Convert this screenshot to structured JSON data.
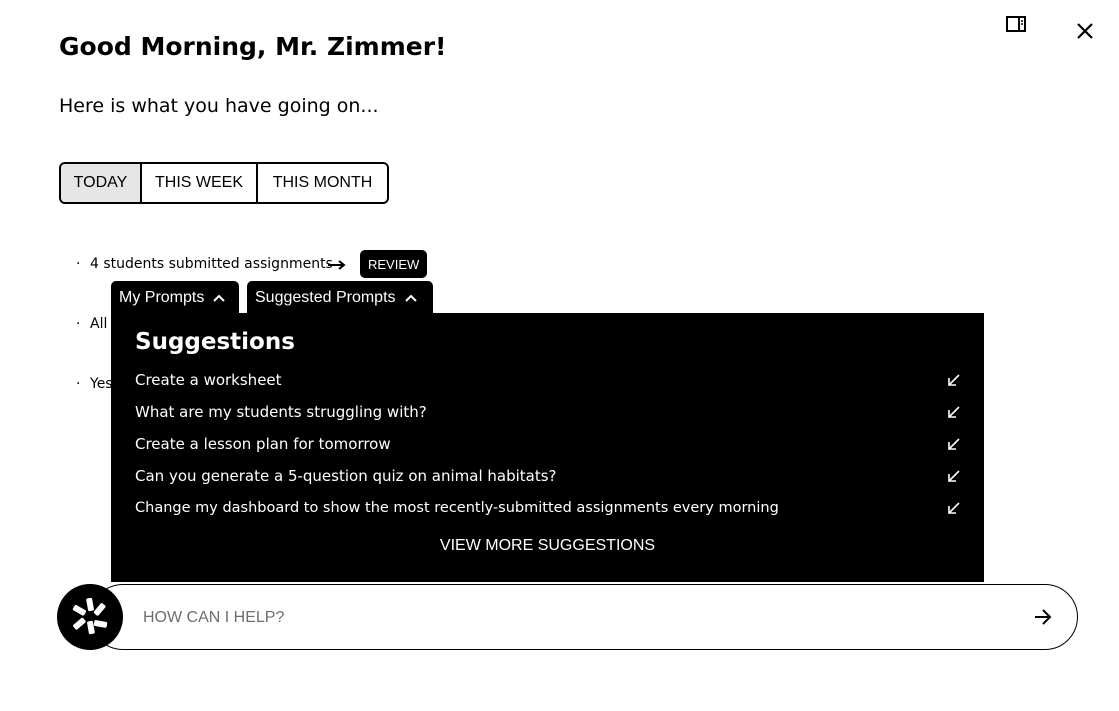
{
  "header": {
    "title": "Good Morning, Mr. Zimmer!",
    "subtitle": "Here is what you have going on..."
  },
  "window_controls": {
    "panel_icon": "side-panel-icon",
    "close_icon": "close-icon"
  },
  "time_filter": {
    "options": [
      "TODAY",
      "THIS WEEK",
      "THIS MONTH"
    ],
    "selected": "TODAY"
  },
  "activity": {
    "items": [
      {
        "text": "4 students submitted assignments",
        "action_label": "REVIEW"
      },
      {
        "text": "All"
      },
      {
        "text": "Yes"
      }
    ]
  },
  "prompt_tabs": {
    "my_prompts": "My Prompts",
    "suggested_prompts": "Suggested Prompts"
  },
  "suggestions": {
    "heading": "Suggestions",
    "items": [
      "Create a worksheet",
      "What are my students struggling with?",
      "Create a lesson plan for tomorrow",
      "Can you generate a 5-question quiz on animal habitats?",
      "Change my dashboard to show the most recently-submitted assignments every morning"
    ],
    "view_more": "VIEW MORE SUGGESTIONS"
  },
  "chat": {
    "placeholder": "HOW CAN I HELP?"
  }
}
